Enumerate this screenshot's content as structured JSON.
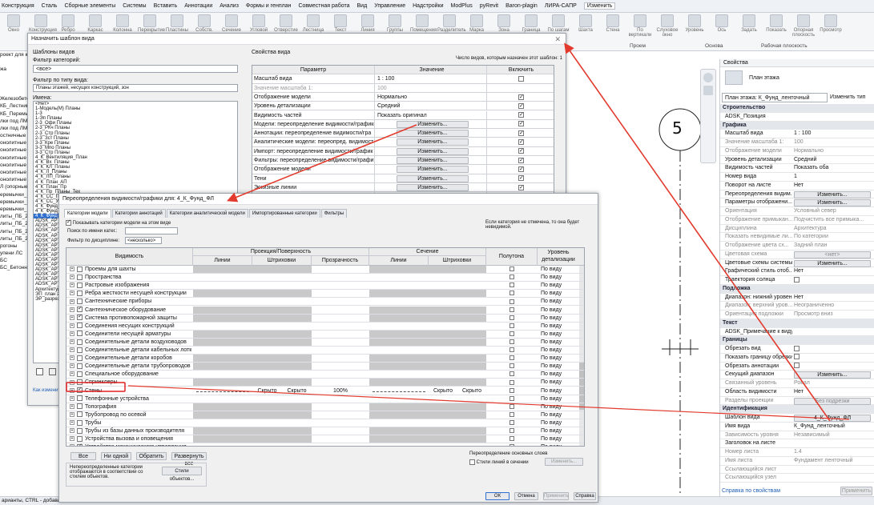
{
  "menu": [
    "Конструкция",
    "Сталь",
    "Сборные элементы",
    "Системы",
    "Вставить",
    "Аннотации",
    "Анализ",
    "Формы и генплан",
    "Совместная работа",
    "Вид",
    "Управление",
    "Надстройки",
    "ModPlus",
    "pyRevit",
    "Baron-plagin",
    "ЛИРА-САПР",
    "Изменить"
  ],
  "ribbon": {
    "buttons": [
      "Окно",
      "Конструкция",
      "Ребро жесткости",
      "Каркас",
      "Колонна",
      "Перекрытие",
      "Пластины",
      "Собств.",
      "Сечение",
      "Угловой",
      "Отверстие",
      "Лестница",
      "Текст",
      "Линия",
      "Группы",
      "Помещения",
      "Разделитель",
      "Марка",
      "Зона",
      "Граница",
      "По шагам",
      "Шахта",
      "Стена",
      "По вертикали",
      "Слуховое окно",
      "Уровень",
      "Ось",
      "Задать",
      "Показать",
      "Опорная плоскость",
      "Просмотр"
    ],
    "groups": {
      "proem": "Проем",
      "osnova": "Основа",
      "workplane": "Рабочая плоскость"
    }
  },
  "left_panel": [
    "роект для ку",
    "",
    "жа",
    "",
    "",
    "",
    "Железобето",
    "КБ_Лестниц",
    "КБ_Перемы",
    "лки под ЛМ",
    "лки под ЛМ",
    "остничные с",
    "онолитные",
    "онолитные",
    "онолитные",
    "онолитные",
    "онолитные",
    "онолитные",
    "Л (опорные",
    "еремычки_Б",
    "еремычки_Б",
    "еремычки_Б",
    "литы_ПБ_22",
    "литы_ПБ_22",
    "литы_ПБ_22",
    "литы_ПБ_22",
    "рогоны",
    "упени ЛС",
    "БС",
    "БС_Бетонна"
  ],
  "status": "арианты, CTRL - добавле",
  "dialog_template": {
    "title": "Назначить шаблон вида",
    "templates_label": "Шаблоны видов",
    "category_filter_label": "Фильтр категорий:",
    "category_filter": "<все>",
    "type_filter_label": "Фильтр по типу вида:",
    "type_filter": "Планы этажей, несущих конструкций, зон",
    "names_label": "Имена:",
    "names": [
      "<Нет>",
      "1-Модель(М) Планы",
      "1-3",
      "1-Эп Планы",
      "2-3_Офи Планы",
      "2-3_РКч Планы",
      "2-3_Стр Планы",
      "2-3_Зст Планы",
      "3-3_Кре Планы",
      "3-3_Мпо Планы",
      "3-3_Стр Планы",
      "4_К_Вентиляция_План",
      "4_К_Вх_Планы",
      "4_К_КЛ_Планы",
      "4_К_Л_Планы",
      "4_К_ЛП_Планы",
      "4_К_План_АП",
      "4_К_План_Пр",
      "4_К_Пр_Планы_Тех",
      "4_К_СС_Планы",
      "4_К_СС_Утеп",
      "4_К_Фунд_ЛП",
      "4_К_Фунд_Сс",
      "4_К_Фунд_ФЛ",
      "ADSK_АР_О",
      "ADSK_АР_О",
      "ADSK_АР_О",
      "ADSK_АР_О",
      "ADSK_АР_О",
      "ADSK_АР_О",
      "ADSK_АР_О",
      "ADSK_АР_О",
      "ADSK_АР_О",
      "ADSK_АР_О",
      "ADSK_АР_О",
      "ADSK_АР_О",
      "ADSK_АР_О",
      "ADSK_АР_О",
      "Архитектур",
      "ЭП_план эт",
      "ЭР_разрезы"
    ],
    "selected_index": 23,
    "props_label": "Свойства вида",
    "count_text": "Число видов, которым назначен этот шаблон:",
    "count": "1",
    "help_link": "Как изменить",
    "columns": [
      "Параметр",
      "Значение",
      "Включить"
    ],
    "rows": [
      {
        "p": "Масштаб вида",
        "v": "1 : 100",
        "c": false,
        "grey": false
      },
      {
        "p": "Значение масштаба    1:",
        "v": "100",
        "c": null,
        "grey": true
      },
      {
        "p": "Отображение модели",
        "v": "Нормально",
        "c": true,
        "grey": false
      },
      {
        "p": "Уровень детализации",
        "v": "Средний",
        "c": true,
        "grey": false
      },
      {
        "p": "Видимость частей",
        "v": "Показать оригинал",
        "c": true,
        "grey": false
      },
      {
        "p": "Модели: переопределение видимости/графики",
        "v": "Изменить...",
        "c": true,
        "btn": true
      },
      {
        "p": "Аннотации: переопределение видимости/гра",
        "v": "Изменить...",
        "c": true,
        "btn": true
      },
      {
        "p": "Аналитические модели: переопред. видимост",
        "v": "Изменить...",
        "c": true,
        "btn": true
      },
      {
        "p": "Импорт: переопределение видимости/график",
        "v": "Изменить...",
        "c": true,
        "btn": true
      },
      {
        "p": "Фильтры: переопределение видимости/графи",
        "v": "Изменить...",
        "c": true,
        "btn": true
      },
      {
        "p": "Отображение модели",
        "v": "Изменить...",
        "c": true,
        "btn": true
      },
      {
        "p": "Тени",
        "v": "Изменить...",
        "c": true,
        "btn": true
      },
      {
        "p": "Эскизные линии",
        "v": "Изменить...",
        "c": true,
        "btn": true
      },
      {
        "p": "Освещение",
        "v": "Изменить...",
        "c": true,
        "btn": true
      }
    ]
  },
  "dialog_vg": {
    "title": "Переопределения видимости/графики для: 4_К_Фунд_ФЛ",
    "tabs": [
      "Категории модели",
      "Категории аннотаций",
      "Категории аналитической модели",
      "Импортированные категории",
      "Фильтры"
    ],
    "show_label": "Показывать категории модели на этом виде",
    "note": "Если категория не отмечена, то она будет невидимой.",
    "search_label": "Поиск по имени катег.:",
    "discipline_label": "Фильтр по дисциплине:",
    "discipline": "<несколько>",
    "headers": {
      "visibility": "Видимость",
      "projection": "Проекция/Поверхность",
      "section": "Сечение",
      "lines": "Линии",
      "hatch": "Штриховки",
      "transparency": "Прозрачность",
      "halftone": "Полутона",
      "detail": "Уровень детализации"
    },
    "rows": [
      {
        "n": "Проемы для шахты",
        "c": false,
        "e": true,
        "d": "По виду"
      },
      {
        "n": "Пространства",
        "c": false,
        "e": true,
        "d": "По виду"
      },
      {
        "n": "Растровые изображения",
        "c": false,
        "e": false,
        "d": "По виду"
      },
      {
        "n": "Ребра жесткости несущей конструкции",
        "c": false,
        "e": true,
        "d": "По виду"
      },
      {
        "n": "Сантехнические приборы",
        "c": false,
        "e": true,
        "d": "По виду"
      },
      {
        "n": "Сантехническое оборудование",
        "c": true,
        "e": true,
        "d": "По виду"
      },
      {
        "n": "Система противопожарной защиты",
        "c": true,
        "e": true,
        "d": "По виду"
      },
      {
        "n": "Соединения несущих конструкций",
        "c": false,
        "e": true,
        "d": "По виду"
      },
      {
        "n": "Соединители несущей арматуры",
        "c": false,
        "e": true,
        "d": "По виду"
      },
      {
        "n": "Соединительные детали воздуховодов",
        "c": false,
        "e": true,
        "d": "По виду"
      },
      {
        "n": "Соединительные детали кабельных лотков",
        "c": false,
        "e": true,
        "d": "По виду"
      },
      {
        "n": "Соединительные детали коробов",
        "c": false,
        "e": true,
        "d": "По виду"
      },
      {
        "n": "Соединительные детали трубопроводов",
        "c": false,
        "e": true,
        "d": "По виду"
      },
      {
        "n": "Специальное оборудование",
        "c": false,
        "e": true,
        "d": "По виду"
      },
      {
        "n": "Спринклеры",
        "c": false,
        "e": true,
        "d": "По виду"
      },
      {
        "n": "Стены",
        "c": true,
        "e": true,
        "d": "По виду",
        "vals": {
          "hatch": "Скрыто",
          "transp": "100%",
          "sec_lines": "Скрыто",
          "sec_hatch": "Скрыто"
        }
      },
      {
        "n": "Телефонные устройства",
        "c": false,
        "e": true,
        "d": "По виду"
      },
      {
        "n": "Топография",
        "c": false,
        "e": true,
        "d": "По виду"
      },
      {
        "n": "Трубопровод по осевой",
        "c": false,
        "e": true,
        "d": "По виду"
      },
      {
        "n": "Трубы",
        "c": false,
        "e": true,
        "d": "По виду"
      },
      {
        "n": "Трубы из базы данных производителя",
        "c": false,
        "e": true,
        "d": "По виду"
      },
      {
        "n": "Устройства вызова и оповещения",
        "c": false,
        "e": true,
        "d": "По виду"
      },
      {
        "n": "Устройства механического управления",
        "c": true,
        "e": true,
        "d": "По виду"
      }
    ],
    "btn_all": "Все",
    "btn_none": "Ни одной",
    "btn_invert": "Обратить",
    "btn_expand": "Развернуть все",
    "overrides_note": "Непереопределенные категории отображаются в соответствии со стилем объектов.",
    "btn_styles": "Стили объектов...",
    "host_label": "Переопределение основных слоев",
    "cut_styles": "Стили линий в сечении",
    "btn_edit": "Изменить...",
    "ok": "ОК",
    "cancel": "Отмена",
    "apply": "Применить",
    "help": "Справка"
  },
  "drawing": {
    "grid_label": "5"
  },
  "properties": {
    "header": "Свойства",
    "type": "План этажа",
    "selector": "План этажа: К_Фунд_ленточный",
    "edit_type": "Изменить тип",
    "rows": [
      {
        "k": "Строительство",
        "s": true
      },
      {
        "k": "ADSK_Позиция",
        "v": ""
      },
      {
        "k": "Графика",
        "s": true
      },
      {
        "k": "Масштаб вида",
        "v": "1 : 100"
      },
      {
        "k": "Значение масштаба    1:",
        "v": "100",
        "g": true
      },
      {
        "k": "Отображение модели",
        "v": "Нормально",
        "g": true
      },
      {
        "k": "Уровень детализации",
        "v": "Средний"
      },
      {
        "k": "Видимость частей",
        "v": "Показать оба"
      },
      {
        "k": "Номер вида",
        "v": "1"
      },
      {
        "k": "Поворот на листе",
        "v": "Нет"
      },
      {
        "k": "Переопределения видим...",
        "b": "Изменить..."
      },
      {
        "k": "Параметры отображени...",
        "b": "Изменить..."
      },
      {
        "k": "Ориентация",
        "v": "Условный север",
        "g": true
      },
      {
        "k": "Отображение примыкан...",
        "v": "Подчистить все примыка...",
        "g": true
      },
      {
        "k": "Дисциплина",
        "v": "Архитектура",
        "g": true
      },
      {
        "k": "Показать невидимые ли...",
        "v": "По категории",
        "g": true
      },
      {
        "k": "Отображение цвета сх...",
        "v": "Задний план",
        "g": true
      },
      {
        "k": "Цветовая схема",
        "b": "<нет>",
        "g": true
      },
      {
        "k": "Цветовые схемы системы",
        "b": "Изменить..."
      },
      {
        "k": "Графический стиль отоб...",
        "v": "Нет"
      },
      {
        "k": "Траектория солнца",
        "cb": true
      },
      {
        "k": "Подложка",
        "s": true
      },
      {
        "k": "Диапазон: нижний уровень",
        "v": "Нет"
      },
      {
        "k": "Диапазон: верхний уров...",
        "v": "Неограниченно",
        "g": true
      },
      {
        "k": "Ориентация подложки",
        "v": "Просмотр вниз",
        "g": true
      },
      {
        "k": "Текст",
        "s": true
      },
      {
        "k": "ADSK_Примечание к виду",
        "v": ""
      },
      {
        "k": "Границы",
        "s": true
      },
      {
        "k": "Обрезать вид",
        "cb": true
      },
      {
        "k": "Показать границу обрезки",
        "cb": true
      },
      {
        "k": "Обрезать аннотации",
        "cb": true
      },
      {
        "k": "Секущий диапазон",
        "b": "Изменить..."
      },
      {
        "k": "Связанный уровень",
        "v": "Ровал",
        "g": true
      },
      {
        "k": "Область видимости",
        "v": "Нет"
      },
      {
        "k": "Разделы проекции",
        "b": "Без подрезки",
        "g": true
      },
      {
        "k": "Идентификация",
        "s": true
      },
      {
        "k": "Шаблон вида",
        "b": "4_К_Фунд_ФЛ"
      },
      {
        "k": "Имя вида",
        "v": "К_Фунд_ленточный"
      },
      {
        "k": "Зависимость уровня",
        "v": "Независимый",
        "g": true
      },
      {
        "k": "Заголовок на листе",
        "v": ""
      },
      {
        "k": "Номер листа",
        "v": "1.4",
        "g": true
      },
      {
        "k": "Имя листа",
        "v": "Фундамент ленточный",
        "g": true
      },
      {
        "k": "Ссылающийся лист",
        "v": "",
        "g": true
      },
      {
        "k": "Ссылающийся узел",
        "v": "",
        "g": true
      }
    ],
    "help_link": "Справка по свойствам",
    "apply": "Применить"
  },
  "colors": {
    "arrow": "#e23b2e",
    "selection": "#2f6fd0",
    "highlight_box": "#e02020"
  }
}
